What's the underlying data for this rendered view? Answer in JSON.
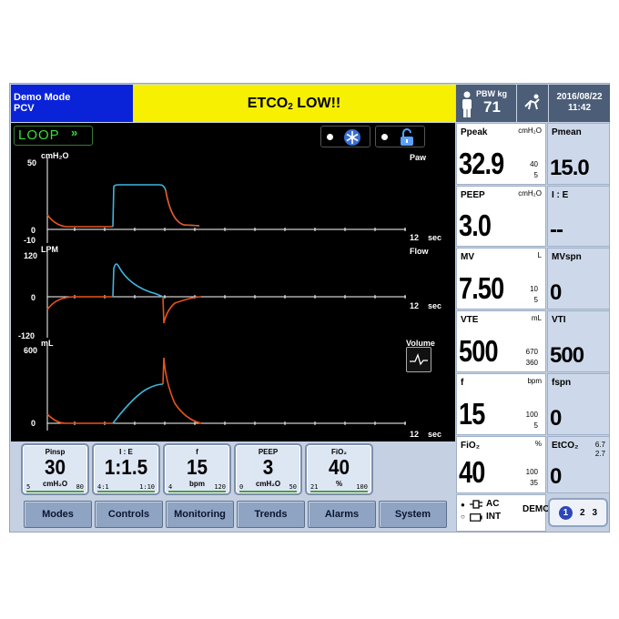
{
  "header": {
    "mode": "Demo Mode",
    "submode": "PCV",
    "alarm": "ETCO",
    "alarm_sub": "2",
    "alarm_suffix": " LOW!!",
    "pbw_label": "PBW kg",
    "pbw_value": "71",
    "date": "2016/08/22",
    "time": "11:42"
  },
  "waveforms": {
    "loop_label": "LOOP",
    "loop_arrows": "»",
    "paw": {
      "name": "Paw",
      "unit": "cmH₂O",
      "y_top": "50",
      "y_zero": "0",
      "y_bottom": "-10",
      "x_end": "12",
      "x_unit": "sec"
    },
    "flow": {
      "name": "Flow",
      "unit": "LPM",
      "y_top": "120",
      "y_zero": "0",
      "y_bottom": "-120",
      "x_end": "12",
      "x_unit": "sec"
    },
    "volume": {
      "name": "Volume",
      "unit": "mL",
      "y_top": "600",
      "y_zero": "0",
      "x_end": "12",
      "x_unit": "sec"
    }
  },
  "params": {
    "ppeak": {
      "name": "Ppeak",
      "unit": "cmH₂O",
      "value": "32.9",
      "hi": "40",
      "lo": "5"
    },
    "pmean": {
      "name": "Pmean",
      "value": "15.0"
    },
    "peep": {
      "name": "PEEP",
      "unit": "cmH₂O",
      "value": "3.0"
    },
    "ie": {
      "name": "I : E",
      "value": "--"
    },
    "mv": {
      "name": "MV",
      "unit": "L",
      "value": "7.50",
      "hi": "10",
      "lo": "5"
    },
    "mvspn": {
      "name": "MVspn",
      "value": "0"
    },
    "vte": {
      "name": "VTE",
      "unit": "mL",
      "value": "500",
      "hi": "670",
      "lo": "360"
    },
    "vti": {
      "name": "VTI",
      "value": "500"
    },
    "f": {
      "name": "f",
      "unit": "bpm",
      "value": "15",
      "hi": "100",
      "lo": "5"
    },
    "fspn": {
      "name": "fspn",
      "value": "0"
    },
    "fio2": {
      "name": "FiO₂",
      "unit": "%",
      "value": "40",
      "hi": "100",
      "lo": "35"
    },
    "etco2": {
      "name": "EtCO₂",
      "value": "0",
      "hi": "6.7",
      "lo": "2.7"
    }
  },
  "controls": [
    {
      "title": "Pinsp",
      "value": "30",
      "unit": "cmH₂O",
      "min": "5",
      "max": "80"
    },
    {
      "title": "I : E",
      "value": "1:1.5",
      "unit": "",
      "min": "4:1",
      "max": "1:10"
    },
    {
      "title": "f",
      "value": "15",
      "unit": "bpm",
      "min": "4",
      "max": "120"
    },
    {
      "title": "PEEP",
      "value": "3",
      "unit": "cmH₂O",
      "min": "0",
      "max": "50"
    },
    {
      "title": "FiO₂",
      "value": "40",
      "unit": "%",
      "min": "21",
      "max": "100"
    }
  ],
  "menu": [
    "Modes",
    "Controls",
    "Monitoring",
    "Trends",
    "Alarms",
    "System"
  ],
  "power": {
    "ac": "AC",
    "int": "INT",
    "demo": "DEMO"
  },
  "pages": [
    "1",
    "2",
    "3"
  ],
  "colors": {
    "alarm_bg": "#f7f000",
    "mode_bg": "#0a23d8",
    "insp_trace": "#3fb6e0",
    "exp_trace": "#e8541c"
  }
}
